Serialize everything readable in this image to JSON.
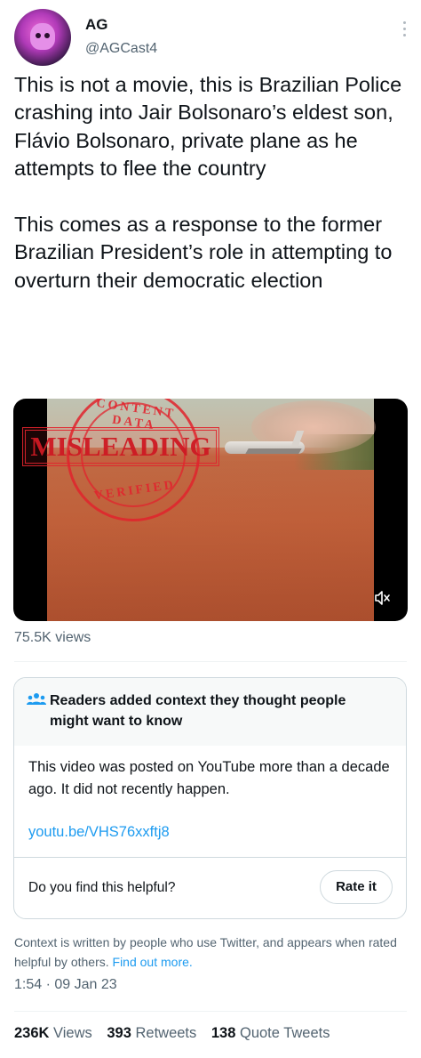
{
  "author": {
    "name": "AG",
    "handle": "@AGCast4"
  },
  "tweet": {
    "text": "This is not a movie, this is Brazilian Police crashing into Jair Bolsonaro’s eldest son, Flávio Bolsonaro, private plane as he attempts to flee the country\n\nThis comes as a response to the former Brazilian President’s role in attempting to overturn their democratic election"
  },
  "media": {
    "stamp_top": "CONTENT DATA",
    "stamp_word": "MISLEADING",
    "stamp_bottom": "VERIFIED",
    "mute_icon": "speaker-muted-icon",
    "views": "75.5K views"
  },
  "community_note": {
    "header": "Readers added context they thought people might want to know",
    "body": "This video was posted on YouTube more than a decade ago. It did not recently happen.",
    "link": "youtu.be/VHS76xxftj8",
    "question": "Do you find this helpful?",
    "rate_label": "Rate it",
    "icon": "people-icon",
    "accent_color": "#1d9bf0"
  },
  "context": {
    "text": "Context is written by people who use Twitter, and appears when rated helpful by others.",
    "link": "Find out more."
  },
  "timestamp": "1:54 · 09 Jan 23",
  "stats": {
    "views_count": "236K",
    "views_label": "Views",
    "retweets_count": "393",
    "retweets_label": "Retweets",
    "quotes_count": "138",
    "quotes_label": "Quote Tweets"
  }
}
